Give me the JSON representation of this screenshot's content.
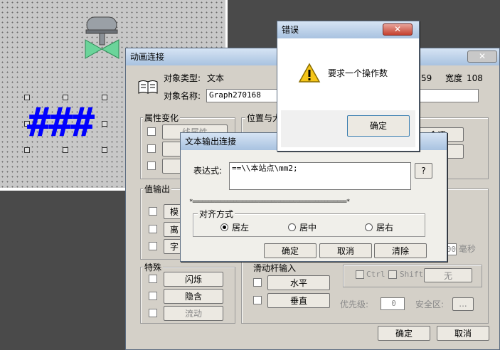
{
  "canvas": {
    "text_object": "###"
  },
  "main_dialog": {
    "title": "动画连接",
    "object_type_label": "对象类型:",
    "object_type_value": "文本",
    "object_name_label": "对象名称:",
    "object_name_value": "Graph270168",
    "top_value_partial": "59",
    "width_label": "宽度",
    "width_value": "108",
    "attr_group": "属性变化",
    "attr_buttons": [
      "线属性",
      "填",
      "文"
    ],
    "pos_group": "位置与大",
    "value_output_group": "值输出",
    "value_output_buttons": [
      "模",
      "离",
      "字"
    ],
    "special_group": "特殊",
    "special_buttons": [
      "闪烁",
      "隐含",
      "流动"
    ],
    "command_group_partial": "滑动杆输入",
    "slider_buttons": [
      "水平",
      "垂直"
    ],
    "right_buttons_partial": [
      "令语",
      "输入"
    ],
    "ms_value": "00",
    "ms_label": "毫秒",
    "ctrl_label": "Ctrl",
    "shift_label": "Shift",
    "hotkey_none": "无",
    "priority_label": "优先级:",
    "priority_value": "0",
    "security_label": "安全区:",
    "security_btn": "...",
    "ok": "确定",
    "cancel": "取消"
  },
  "text_output_dialog": {
    "title": "文本输出连接",
    "expr_label": "表达式:",
    "expr_value": "==\\\\本站点\\mm2;",
    "help_btn": "?",
    "separator": "*=================================================*",
    "align_group": "对齐方式",
    "align_left": "居左",
    "align_center": "居中",
    "align_right": "居右",
    "ok": "确定",
    "cancel": "取消",
    "clear": "清除"
  },
  "error_dialog": {
    "title": "错误",
    "close": "✕",
    "message": "要求一个操作数",
    "ok": "确定"
  }
}
